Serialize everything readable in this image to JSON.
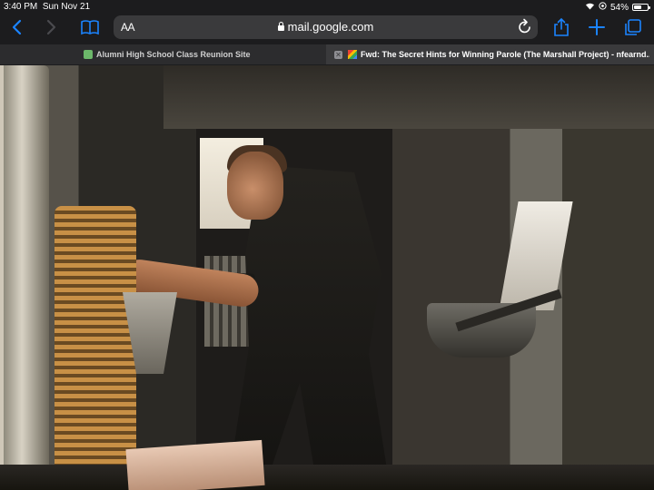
{
  "status_bar": {
    "time": "3:40 PM",
    "date": "Sun Nov 21",
    "battery": "54%",
    "battery_level": 0.54
  },
  "toolbar": {
    "text_size_label": "AA",
    "url": "mail.google.com",
    "icons": [
      "back-icon",
      "forward-icon",
      "bookmarks-icon",
      "lock-icon",
      "reload-icon",
      "share-icon",
      "new-tab-icon",
      "tabs-icon"
    ]
  },
  "tabs": [
    {
      "title": "Alumni High School Class Reunion Site",
      "active": false
    },
    {
      "title": "Fwd: The Secret Hints for Winning Parole (The Marshall Project) - nfearnd...",
      "active": true
    }
  ],
  "colors": {
    "accent": "#1b84ff",
    "address_bar": "#3a3a3c",
    "toolbar_bg": "#1c1c1e"
  }
}
